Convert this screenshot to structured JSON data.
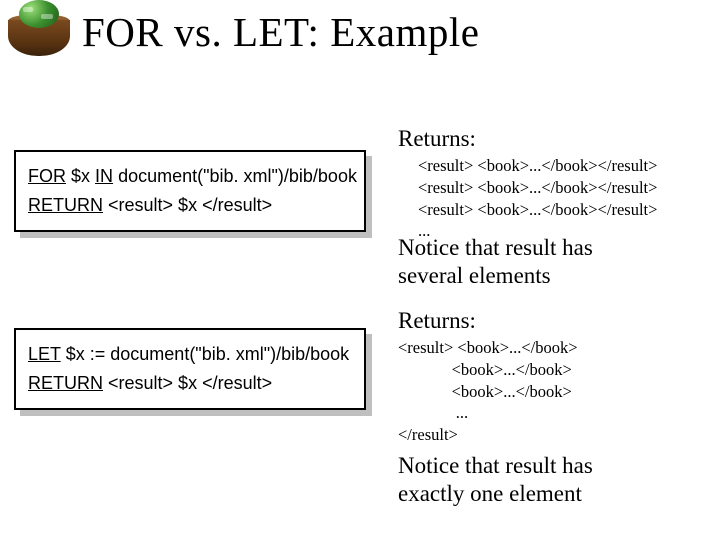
{
  "title": "FOR vs. LET: Example",
  "for_box": {
    "kw1": "FOR",
    "var": "$x",
    "kw_in": "IN",
    "src": "document(\"bib. xml\")/bib/book",
    "kw_ret": "RETURN",
    "expr": "<result> $x </result>"
  },
  "let_box": {
    "kw1": "LET",
    "var": "$x",
    "assign": ":=",
    "src": "document(\"bib. xml\")/bib/book",
    "kw_ret": "RETURN",
    "expr": "<result> $x </result>"
  },
  "right_for": {
    "heading": "Returns:",
    "output": "<result> <book>...</book></result>\n<result> <book>...</book></result>\n<result> <book>...</book></result>\n...",
    "notice_l1": "Notice that result has",
    "notice_l2": "several elements"
  },
  "right_let": {
    "heading": "Returns:",
    "output": "<result> <book>...</book>\n             <book>...</book>\n             <book>...</book>\n              ...\n</result>",
    "notice_l1": "Notice that result has",
    "notice_l2": "exactly one element"
  }
}
